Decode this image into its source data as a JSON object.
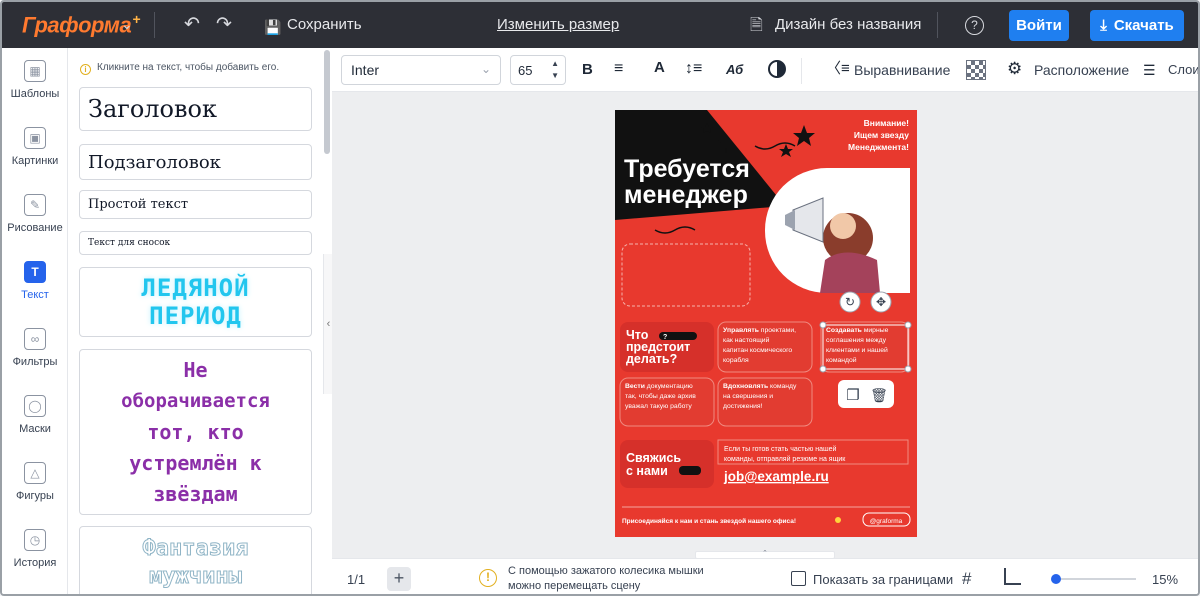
{
  "topbar": {
    "logo": "Граформа",
    "logo_plus": "+",
    "save_label": "Сохранить",
    "resize_label": "Изменить размер",
    "doc_title": "Дизайн без названия",
    "login_label": "Войти",
    "download_label": "Скачать"
  },
  "sidebar": {
    "items": [
      {
        "label": "Шаблоны",
        "icon": "templates-icon"
      },
      {
        "label": "Картинки",
        "icon": "image-icon"
      },
      {
        "label": "Рисование",
        "icon": "pencil-icon"
      },
      {
        "label": "Текст",
        "icon": "text-icon"
      },
      {
        "label": "Фильтры",
        "icon": "filters-icon"
      },
      {
        "label": "Маски",
        "icon": "mask-icon"
      },
      {
        "label": "Фигуры",
        "icon": "shapes-icon"
      },
      {
        "label": "История",
        "icon": "history-icon"
      }
    ],
    "active": "Текст"
  },
  "panel": {
    "hint": "Кликните на текст, чтобы добавить его.",
    "heading": "Заголовок",
    "subheading": "Подзаголовок",
    "plain": "Простой текст",
    "footnote": "Текст для сносок",
    "effect1_line1": "ЛЕДЯНОЙ",
    "effect1_line2": "ПЕРИОД",
    "effect2": [
      "Не",
      "оборачивается",
      "тот, кто",
      "устремлён к",
      "звёздам"
    ],
    "effect3_line1": "Фантазия",
    "effect3_line2": "мужчины"
  },
  "toolbar": {
    "font": "Inter",
    "size": "65",
    "bold": "B",
    "font_color": "A",
    "case": "Аб",
    "align_label": "Выравнивание",
    "arrange_label": "Расположение",
    "layers_label": "Слои"
  },
  "poster": {
    "note_lines": [
      "Внимание!",
      "Ищем звезду",
      "Менеджмента!"
    ],
    "title_lines": [
      "Требуется",
      "менеджер"
    ],
    "question_lines": [
      "Что",
      "предстоит",
      "делать?"
    ],
    "question_badge": "?",
    "tasks": [
      {
        "hl": "Управлять",
        "rest": [
          " проектами,",
          "как настоящий",
          "капитан космического",
          "корабля"
        ]
      },
      {
        "hl": "Создавать",
        "rest": [
          " мирные",
          "соглашения между",
          "клиентами и нашей",
          "командой"
        ]
      },
      {
        "hl": "Вести",
        "rest": [
          " документацию",
          "так, чтобы даже архив",
          "уважал такую работу"
        ]
      },
      {
        "hl": "Вдохновлять",
        "rest": [
          " команду",
          "на свершения и",
          "достижения!"
        ]
      }
    ],
    "contact_lines": [
      "Свяжись",
      "с нами"
    ],
    "apply_lines": [
      "Если ты готов стать частью нашей",
      "команды, отправляй резюме на ящик"
    ],
    "email": "job@example.ru",
    "footer": "Присоединяйся к нам и стань звездой нашего офиса!",
    "handle": "@graforma"
  },
  "bottom": {
    "page": "1/1",
    "hint_line1": "С помощью зажатого колесика мышки",
    "hint_line2": "можно перемещать сцену",
    "show_outside": "Показать за границами",
    "zoom": "15%",
    "zoom_fraction": 0.05
  },
  "colors": {
    "topbar": "#2d2f36",
    "accent": "#1f7ff0",
    "poster_red": "#e8392e",
    "logo": "#ff7a2f"
  }
}
